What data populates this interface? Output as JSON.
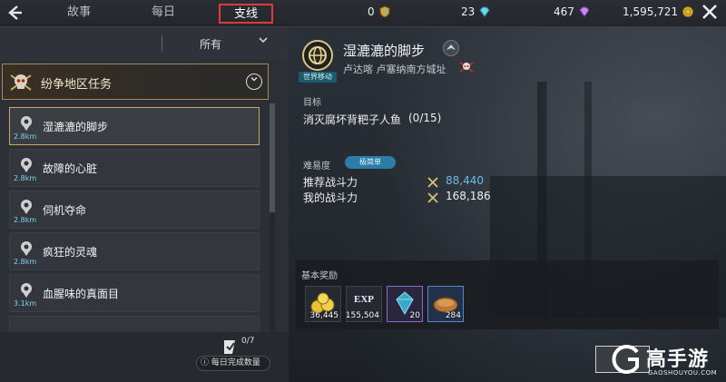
{
  "topbar": {
    "tabs": [
      {
        "label": "故事"
      },
      {
        "label": "每日"
      },
      {
        "label": "支线"
      }
    ],
    "active_tab": "支线",
    "currencies": [
      {
        "icon": "shield-token-icon",
        "value": "0",
        "color": "#e0a030"
      },
      {
        "icon": "cyan-diamond-icon",
        "value": "23",
        "color": "#6fd6e6"
      },
      {
        "icon": "purple-diamond-icon",
        "value": "467",
        "color": "#c78bf0"
      },
      {
        "icon": "gold-coin-icon",
        "value": "1,595,721",
        "color": "#e6b93a"
      }
    ]
  },
  "filter": {
    "selected": "所有"
  },
  "region": {
    "title": "纷争地区任务"
  },
  "quests": [
    {
      "name": "湿漉漉的脚步",
      "distance": "2.8km",
      "selected": true
    },
    {
      "name": "故障的心脏",
      "distance": "2.8km",
      "selected": false
    },
    {
      "name": "伺机夺命",
      "distance": "2.8km",
      "selected": false
    },
    {
      "name": "疯狂的灵魂",
      "distance": "2.8km",
      "selected": false
    },
    {
      "name": "血腥味的真面目",
      "distance": "3.1km",
      "selected": false
    }
  ],
  "daily": {
    "count": "0/7",
    "button_label": "每日完成数量"
  },
  "detail": {
    "title": "湿漉漉的脚步",
    "world_tag": "世界移动",
    "location": "卢达喀 卢塞纳南方城址",
    "objective_label": "目标",
    "objective": "消灭腐坏背粑子人鱼",
    "objective_progress": "(0/15)",
    "difficulty_label": "难易度",
    "difficulty": "极简单",
    "recommended_label": "推荐战斗力",
    "recommended_value": "88,440",
    "my_label": "我的战斗力",
    "my_value": "168,186"
  },
  "rewards": {
    "title": "基本奖励",
    "items": [
      {
        "icon": "gold-pile-icon",
        "count": "36,445"
      },
      {
        "icon": "exp-icon",
        "label": "EXP",
        "count": "155,504"
      },
      {
        "icon": "crystal-icon",
        "count": "20"
      },
      {
        "icon": "bread-icon",
        "count": "284"
      }
    ]
  },
  "watermark": {
    "title": "高手游",
    "subtitle": "GAOSHOUYOU.COM"
  },
  "colors": {
    "accent_red": "#e03a3a",
    "selected_gold": "#c9a867",
    "recommended_blue": "#6fb9ea",
    "distance_cyan": "#7fd3f0"
  }
}
